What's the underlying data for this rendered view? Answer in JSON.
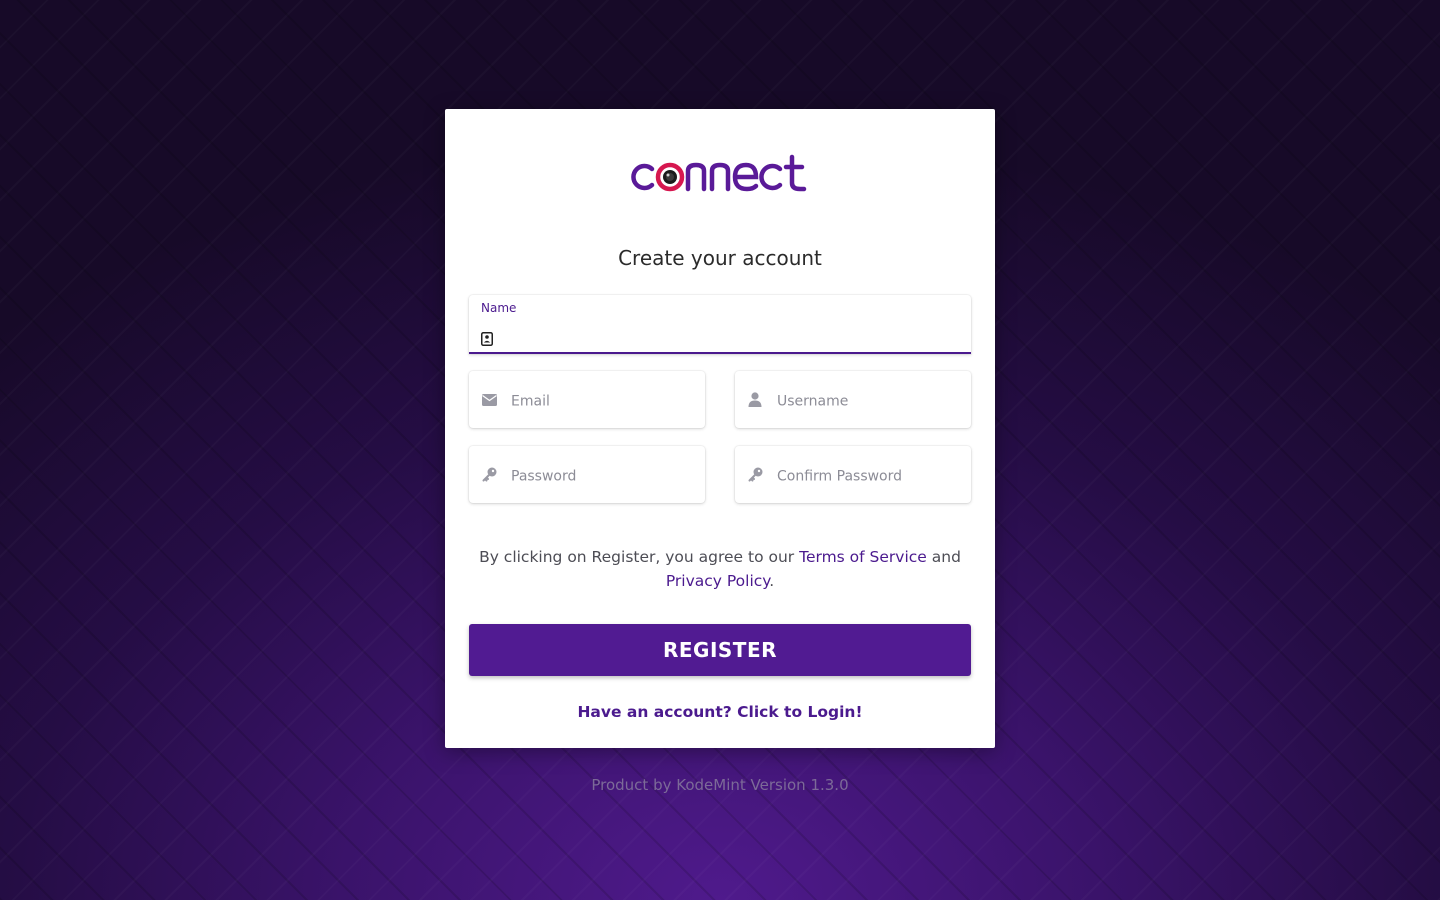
{
  "brand": {
    "logo_text": "connect",
    "colors": {
      "accent": "#4b1a8e",
      "button": "#511b92",
      "logo_ring": "#d6174f"
    }
  },
  "form": {
    "title": "Create your account",
    "name": {
      "label": "Name",
      "value": "",
      "icon": "contact-card-icon"
    },
    "email": {
      "placeholder": "Email",
      "icon": "envelope-icon"
    },
    "username": {
      "placeholder": "Username",
      "icon": "user-icon"
    },
    "password": {
      "placeholder": "Password",
      "icon": "key-icon"
    },
    "confirm_password": {
      "placeholder": "Confirm Password",
      "icon": "key-icon"
    }
  },
  "agreement": {
    "prefix": "By clicking on Register, you agree to our ",
    "terms_link": "Terms of Service",
    "middle": " and ",
    "privacy_link": "Privacy Policy",
    "suffix": "."
  },
  "actions": {
    "register_label": "REGISTER",
    "login_link": "Have an account? Click to Login!"
  },
  "footer": {
    "text": "Product by KodeMint Version 1.3.0"
  }
}
